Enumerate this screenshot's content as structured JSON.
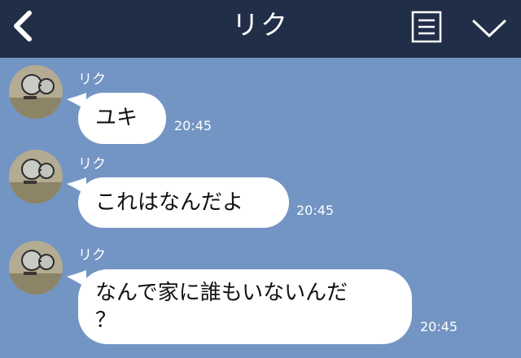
{
  "header": {
    "title": "リク"
  },
  "messages": [
    {
      "sender": "リク",
      "text": "ユキ",
      "time": "20:45"
    },
    {
      "sender": "リク",
      "text": "これはなんだよ",
      "time": "20:45"
    },
    {
      "sender": "リク",
      "text_line1": "なんで家に誰もいないんだ",
      "text_line2": "？",
      "time": "20:45"
    }
  ],
  "colors": {
    "background": "#7395c3",
    "header": "#212e47",
    "bubble": "#ffffff"
  },
  "icons": {
    "back": "chevron-left-icon",
    "menu": "menu-list-icon",
    "collapse": "chevron-down-icon"
  }
}
